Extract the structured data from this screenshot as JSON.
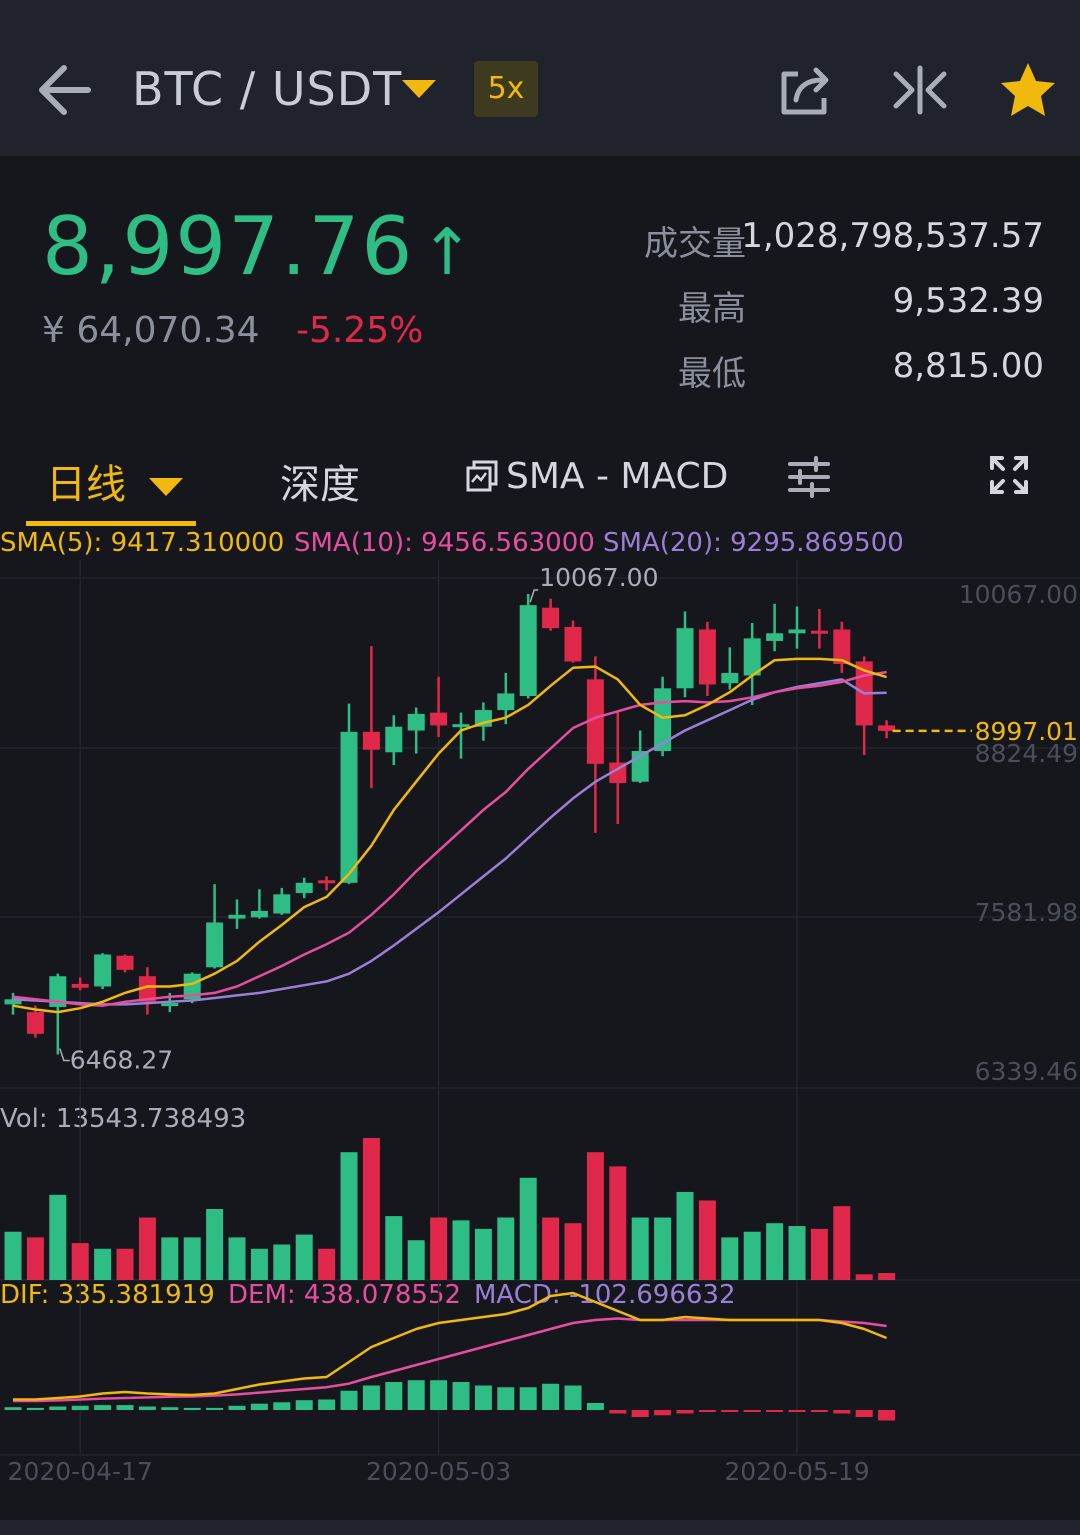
{
  "header": {
    "back_icon": "arrow-left-icon",
    "pair": "BTC / USDT",
    "leverage": "5x",
    "share_icon": "share-icon",
    "compare_icon": "split-arrows-icon",
    "favorite_icon": "star-icon",
    "accent": "#f0b90b"
  },
  "ticker": {
    "price": "8,997.76",
    "direction": "↑",
    "cny": "¥ 64,070.34",
    "change": "-5.25%",
    "up_color": "#2ebd85",
    "down_color": "#e0294a"
  },
  "stats": [
    {
      "label": "成交量",
      "value": "1,028,798,537.57"
    },
    {
      "label": "最高",
      "value": "9,532.39"
    },
    {
      "label": "最低",
      "value": "8,815.00"
    }
  ],
  "tabs": {
    "interval": "日线",
    "depth": "深度",
    "indicator": "SMA - MACD",
    "settings_icon": "sliders-icon",
    "fullscreen_icon": "expand-icon"
  },
  "sma_legend": {
    "sma5": "SMA(5): 9417.310000",
    "sma10": "SMA(10): 9456.563000",
    "sma20": "SMA(20): 9295.869500"
  },
  "vol_legend": "Vol: 13543.738493",
  "macd_legend": {
    "dif": "DIF: 335.381919",
    "dem": "DEM: 438.078552",
    "macd": "MACD: -102.696632"
  },
  "chart_data": {
    "type": "candlestick",
    "price_axis": {
      "ticks": [
        10067.0,
        8824.49,
        7581.98,
        6339.46
      ],
      "range": [
        6339.46,
        10067.0
      ]
    },
    "high_marker": "10067.00",
    "low_marker": "6468.27",
    "last_price_label": "8997.01",
    "last_price": 8997.01,
    "date_ticks": [
      "2020-04-17",
      "2020-05-03",
      "2020-05-19"
    ],
    "date_tick_index": [
      3,
      19,
      35
    ],
    "candles": [
      {
        "o": 6860,
        "h": 6950,
        "l": 6780,
        "c": 6900
      },
      {
        "o": 6800,
        "h": 6850,
        "l": 6600,
        "c": 6630
      },
      {
        "o": 6840,
        "h": 7100,
        "l": 6468.27,
        "c": 7080
      },
      {
        "o": 7020,
        "h": 7070,
        "l": 6970,
        "c": 6990
      },
      {
        "o": 7000,
        "h": 7260,
        "l": 6980,
        "c": 7250
      },
      {
        "o": 7240,
        "h": 7250,
        "l": 7110,
        "c": 7130
      },
      {
        "o": 7080,
        "h": 7150,
        "l": 6780,
        "c": 6880
      },
      {
        "o": 6850,
        "h": 6950,
        "l": 6800,
        "c": 6870
      },
      {
        "o": 6900,
        "h": 7110,
        "l": 6870,
        "c": 7100
      },
      {
        "o": 7150,
        "h": 7800,
        "l": 7140,
        "c": 7500
      },
      {
        "o": 7530,
        "h": 7680,
        "l": 7450,
        "c": 7560
      },
      {
        "o": 7540,
        "h": 7760,
        "l": 7530,
        "c": 7590
      },
      {
        "o": 7570,
        "h": 7770,
        "l": 7560,
        "c": 7720
      },
      {
        "o": 7730,
        "h": 7850,
        "l": 7690,
        "c": 7810
      },
      {
        "o": 7830,
        "h": 7860,
        "l": 7750,
        "c": 7810
      },
      {
        "o": 7810,
        "h": 9210,
        "l": 7800,
        "c": 8990
      },
      {
        "o": 8990,
        "h": 9660,
        "l": 8550,
        "c": 8850
      },
      {
        "o": 8830,
        "h": 9120,
        "l": 8730,
        "c": 9030
      },
      {
        "o": 9000,
        "h": 9180,
        "l": 8820,
        "c": 9130
      },
      {
        "o": 9140,
        "h": 9420,
        "l": 8950,
        "c": 9040
      },
      {
        "o": 9040,
        "h": 9140,
        "l": 8780,
        "c": 9050
      },
      {
        "o": 9030,
        "h": 9220,
        "l": 8920,
        "c": 9160
      },
      {
        "o": 9160,
        "h": 9450,
        "l": 9050,
        "c": 9290
      },
      {
        "o": 9270,
        "h": 10067.0,
        "l": 9250,
        "c": 9980
      },
      {
        "o": 9960,
        "h": 10030,
        "l": 9780,
        "c": 9800
      },
      {
        "o": 9810,
        "h": 9860,
        "l": 9530,
        "c": 9540
      },
      {
        "o": 9400,
        "h": 9580,
        "l": 8200,
        "c": 8740
      },
      {
        "o": 8750,
        "h": 9150,
        "l": 8270,
        "c": 8590
      },
      {
        "o": 8600,
        "h": 9000,
        "l": 8590,
        "c": 8840
      },
      {
        "o": 8840,
        "h": 9420,
        "l": 8800,
        "c": 9330
      },
      {
        "o": 9330,
        "h": 9930,
        "l": 9260,
        "c": 9800
      },
      {
        "o": 9790,
        "h": 9850,
        "l": 9270,
        "c": 9360
      },
      {
        "o": 9370,
        "h": 9650,
        "l": 9320,
        "c": 9450
      },
      {
        "o": 9430,
        "h": 9840,
        "l": 9200,
        "c": 9720
      },
      {
        "o": 9700,
        "h": 9990,
        "l": 9620,
        "c": 9760
      },
      {
        "o": 9760,
        "h": 9970,
        "l": 9640,
        "c": 9790
      },
      {
        "o": 9780,
        "h": 9950,
        "l": 9640,
        "c": 9770
      },
      {
        "o": 9790,
        "h": 9850,
        "l": 9450,
        "c": 9520
      },
      {
        "o": 9540,
        "h": 9580,
        "l": 8810,
        "c": 9040
      },
      {
        "o": 9040,
        "h": 9080,
        "l": 8940,
        "c": 8997.01
      }
    ],
    "sma5": [
      6850,
      6820,
      6800,
      6830,
      6880,
      6950,
      7000,
      7000,
      7020,
      7100,
      7200,
      7350,
      7480,
      7620,
      7700,
      7880,
      8100,
      8380,
      8600,
      8820,
      9000,
      9060,
      9100,
      9200,
      9350,
      9490,
      9500,
      9400,
      9200,
      9100,
      9120,
      9200,
      9300,
      9430,
      9550,
      9560,
      9560,
      9550,
      9470,
      9417.31
    ],
    "sma10": [
      6920,
      6900,
      6880,
      6860,
      6850,
      6880,
      6900,
      6920,
      6930,
      6950,
      7000,
      7080,
      7160,
      7250,
      7330,
      7420,
      7560,
      7720,
      7900,
      8060,
      8220,
      8380,
      8520,
      8700,
      8860,
      9020,
      9100,
      9150,
      9200,
      9220,
      9230,
      9220,
      9230,
      9260,
      9300,
      9330,
      9350,
      9380,
      9430,
      9456.56
    ],
    "sma20": [
      6900,
      6890,
      6880,
      6870,
      6860,
      6860,
      6870,
      6880,
      6890,
      6910,
      6930,
      6950,
      6980,
      7010,
      7040,
      7100,
      7200,
      7320,
      7450,
      7580,
      7720,
      7860,
      8000,
      8160,
      8320,
      8470,
      8600,
      8700,
      8800,
      8900,
      9000,
      9080,
      9160,
      9240,
      9300,
      9340,
      9370,
      9400,
      9290,
      9295.87
    ],
    "volume_max": 100,
    "volume": [
      34,
      30,
      60,
      26,
      22,
      22,
      44,
      30,
      30,
      50,
      30,
      22,
      25,
      32,
      22,
      90,
      100,
      45,
      28,
      44,
      42,
      36,
      44,
      72,
      44,
      40,
      90,
      80,
      44,
      44,
      62,
      56,
      30,
      34,
      40,
      38,
      36,
      52,
      4,
      0
    ],
    "dif": [
      35,
      35,
      40,
      45,
      55,
      60,
      55,
      52,
      50,
      55,
      70,
      85,
      95,
      105,
      110,
      160,
      210,
      240,
      270,
      290,
      300,
      310,
      320,
      340,
      380,
      390,
      360,
      330,
      300,
      300,
      310,
      305,
      300,
      300,
      300,
      300,
      300,
      290,
      270,
      240
    ],
    "dem": [
      30,
      30,
      32,
      35,
      38,
      40,
      42,
      44,
      45,
      48,
      52,
      58,
      64,
      70,
      76,
      88,
      110,
      130,
      150,
      170,
      190,
      210,
      230,
      250,
      270,
      290,
      300,
      305,
      300,
      300,
      300,
      300,
      300,
      300,
      300,
      300,
      300,
      295,
      290,
      280
    ],
    "macd": [
      8,
      6,
      10,
      12,
      14,
      14,
      10,
      8,
      6,
      6,
      12,
      18,
      22,
      28,
      30,
      55,
      70,
      80,
      85,
      85,
      80,
      70,
      65,
      65,
      75,
      70,
      20,
      -10,
      -20,
      -15,
      -10,
      -5,
      -5,
      -5,
      -5,
      -5,
      -5,
      -10,
      -20,
      -30
    ]
  }
}
